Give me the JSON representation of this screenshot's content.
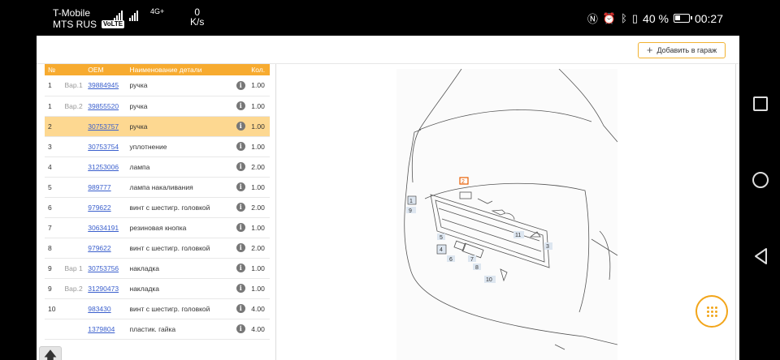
{
  "status_bar": {
    "carrier1": "T-Mobile",
    "carrier2": "MTS RUS",
    "volte": "VoLTE",
    "network": "4G+",
    "speed_value": "0",
    "speed_unit": "K/s",
    "battery_percent": "40 %",
    "time": "00:27"
  },
  "toolbar": {
    "garage_label": "Добавить в гараж"
  },
  "table": {
    "headers": [
      "№",
      "OEM",
      "Наименование детали",
      "Кол."
    ],
    "rows": [
      {
        "num": "1",
        "var": "Вар.1",
        "oem": "39884945",
        "name": "ручка",
        "qty": "1.00"
      },
      {
        "num": "1",
        "var": "Вар.2",
        "oem": "39855520",
        "name": "ручка",
        "qty": "1.00"
      },
      {
        "num": "2",
        "var": "",
        "oem": "30753757",
        "name": "ручка",
        "qty": "1.00"
      },
      {
        "num": "3",
        "var": "",
        "oem": "30753754",
        "name": "уплотнение",
        "qty": "1.00"
      },
      {
        "num": "4",
        "var": "",
        "oem": "31253006",
        "name": "лампа",
        "qty": "2.00"
      },
      {
        "num": "5",
        "var": "",
        "oem": "989777",
        "name": "лампа накаливания",
        "qty": "1.00"
      },
      {
        "num": "6",
        "var": "",
        "oem": "979622",
        "name": "винт с шестигр. головкой",
        "qty": "2.00"
      },
      {
        "num": "7",
        "var": "",
        "oem": "30634191",
        "name": "резиновая кнопка",
        "qty": "1.00"
      },
      {
        "num": "8",
        "var": "",
        "oem": "979622",
        "name": "винт с шестигр. головкой",
        "qty": "2.00"
      },
      {
        "num": "9",
        "var": "Вар 1",
        "oem": "30753756",
        "name": "накладка",
        "qty": "1.00"
      },
      {
        "num": "9",
        "var": "Вар.2",
        "oem": "31290473",
        "name": "накладка",
        "qty": "1.00"
      },
      {
        "num": "10",
        "var": "",
        "oem": "983430",
        "name": "винт с шестигр. головкой",
        "qty": "4.00"
      },
      {
        "num": "",
        "var": "",
        "oem": "1379804",
        "name": "пластик. гайка",
        "qty": "4.00"
      }
    ],
    "selected_index": 2
  },
  "diagram": {
    "callouts": [
      "1",
      "2",
      "3",
      "4",
      "5",
      "6",
      "7",
      "8",
      "9",
      "10",
      "11"
    ]
  },
  "colors": {
    "accent": "#f7ab30",
    "selected_row": "#fdd891",
    "link": "#3a5fcd",
    "fab_ring": "#f2a51a"
  },
  "icons": {
    "info": "info-icon",
    "scroll_top": "arrow-up-icon",
    "fab": "apps-grid-icon"
  }
}
